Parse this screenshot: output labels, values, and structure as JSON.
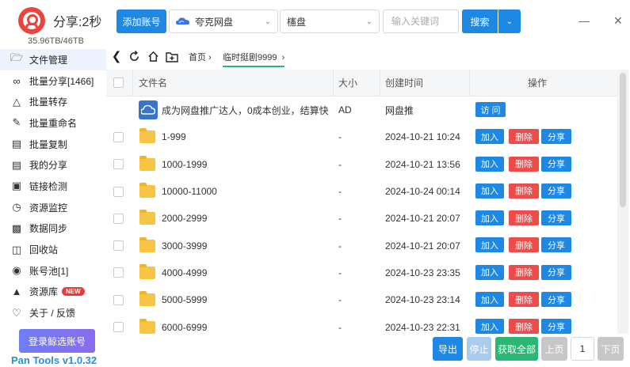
{
  "app": {
    "name": "分享:2秒",
    "storage": "35.96TB/46TB",
    "version": "Pan Tools v1.0.32",
    "login_label": "登录鲸选账号"
  },
  "sidebar": {
    "items": [
      {
        "label": "文件管理",
        "icon": "folder-icon"
      },
      {
        "label": "批量分享[1466]",
        "icon": "share-icon"
      },
      {
        "label": "批量转存",
        "icon": "transfer-icon"
      },
      {
        "label": "批量重命名",
        "icon": "rename-icon"
      },
      {
        "label": "批量复制",
        "icon": "copy-icon"
      },
      {
        "label": "我的分享",
        "icon": "my-share-icon"
      },
      {
        "label": "链接检测",
        "icon": "link-check-icon"
      },
      {
        "label": "资源监控",
        "icon": "monitor-icon"
      },
      {
        "label": "数据同步",
        "icon": "sync-icon"
      },
      {
        "label": "回收站",
        "icon": "trash-icon"
      },
      {
        "label": "账号池[1]",
        "icon": "account-pool-icon"
      },
      {
        "label": "资源库",
        "icon": "library-icon",
        "badge": "NEW"
      },
      {
        "label": "关于 / 反馈",
        "icon": "bell-icon"
      }
    ]
  },
  "toolbar": {
    "add_account": "添加账号",
    "pan_select": "夸克网盘",
    "type_select": "櫶盘",
    "search_placeholder": "输入关键词",
    "search_label": "搜索"
  },
  "breadcrumb": {
    "home": "首页",
    "current": "临时挺剧9999"
  },
  "table": {
    "headers": {
      "name": "文件名",
      "size": "大小",
      "created": "创建时间",
      "actions": "操作"
    },
    "ad_row": {
      "name": "成为网盘推广达人，0成本创业，结算快",
      "size": "AD",
      "created": "网盘推",
      "action": "访 问"
    },
    "rows": [
      {
        "name": "1-999",
        "size": "-",
        "created": "2024-10-21 10:24"
      },
      {
        "name": "1000-1999",
        "size": "-",
        "created": "2024-10-21 13:56"
      },
      {
        "name": "10000-11000",
        "size": "-",
        "created": "2024-10-24 00:14"
      },
      {
        "name": "2000-2999",
        "size": "-",
        "created": "2024-10-21 20:07"
      },
      {
        "name": "3000-3999",
        "size": "-",
        "created": "2024-10-21 20:07"
      },
      {
        "name": "4000-4999",
        "size": "-",
        "created": "2024-10-23 23:35"
      },
      {
        "name": "5000-5999",
        "size": "-",
        "created": "2024-10-23 23:14"
      },
      {
        "name": "6000-6999",
        "size": "-",
        "created": "2024-10-23 22:31"
      }
    ],
    "actions": {
      "add": "加入",
      "delete": "删除",
      "share": "分享"
    }
  },
  "footer": {
    "export": "导出",
    "stop": "停止",
    "fetch_all": "获取全部",
    "prev": "上页",
    "page": "1",
    "next": "下页"
  },
  "colors": {
    "primary": "#1e88e5",
    "danger": "#ee4b4b",
    "success": "#2bb673",
    "disabled": "#a9cbee"
  }
}
